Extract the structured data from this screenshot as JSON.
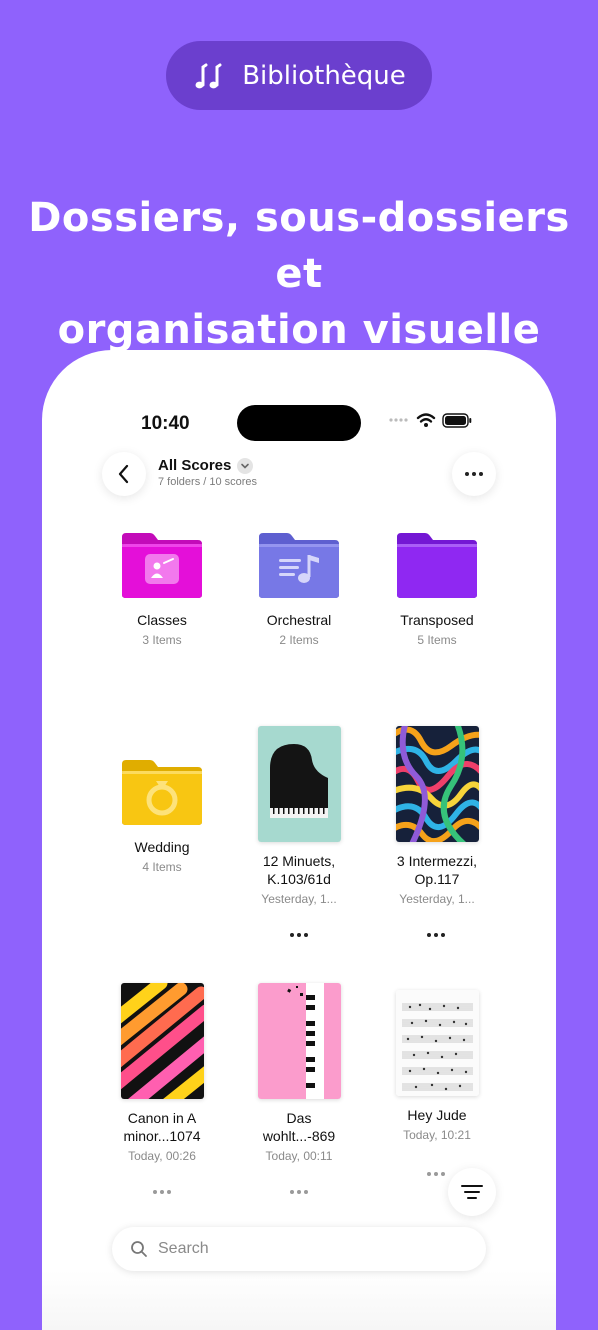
{
  "promo": {
    "badge_label": "Bibliothèque",
    "headline_line1": "Dossiers, sous-dossiers et",
    "headline_line2": "organisation visuelle",
    "background_color": "#8f62fc"
  },
  "status_bar": {
    "time": "10:40"
  },
  "header": {
    "title": "All Scores",
    "subtitle": "7 folders / 10 scores"
  },
  "folders": [
    {
      "name": "Classes",
      "meta": "3 Items",
      "color": "#e40fd9",
      "icon": "presentation-icon"
    },
    {
      "name": "Orchestral",
      "meta": "2 Items",
      "color": "#7778e6",
      "icon": "music-note-icon"
    },
    {
      "name": "Transposed",
      "meta": "5 Items",
      "color": "#8f28f2",
      "icon": "none"
    },
    {
      "name": "Wedding",
      "meta": "4 Items",
      "color": "#f8c612",
      "icon": "ring-icon"
    }
  ],
  "scores": [
    {
      "name_line1": "12 Minuets,",
      "name_line2": "K.103/61d",
      "meta": "Yesterday, 1...",
      "cover": "grand-piano"
    },
    {
      "name_line1": "3 Intermezzi,",
      "name_line2": "Op.117",
      "meta": "Yesterday, 1...",
      "cover": "colorful-squiggles"
    },
    {
      "name_line1": "Canon in A",
      "name_line2": "minor...1074",
      "meta": "Today, 00:26",
      "cover": "gradient-stripes"
    },
    {
      "name_line1": "Das",
      "name_line2": "wohlt...-869",
      "meta": "Today, 00:11",
      "cover": "pink-piano-keys"
    },
    {
      "name_line1": "Hey Jude",
      "name_line2": "",
      "meta": "Today, 10:21",
      "cover": "sheet-music"
    }
  ],
  "search": {
    "placeholder": "Search"
  }
}
